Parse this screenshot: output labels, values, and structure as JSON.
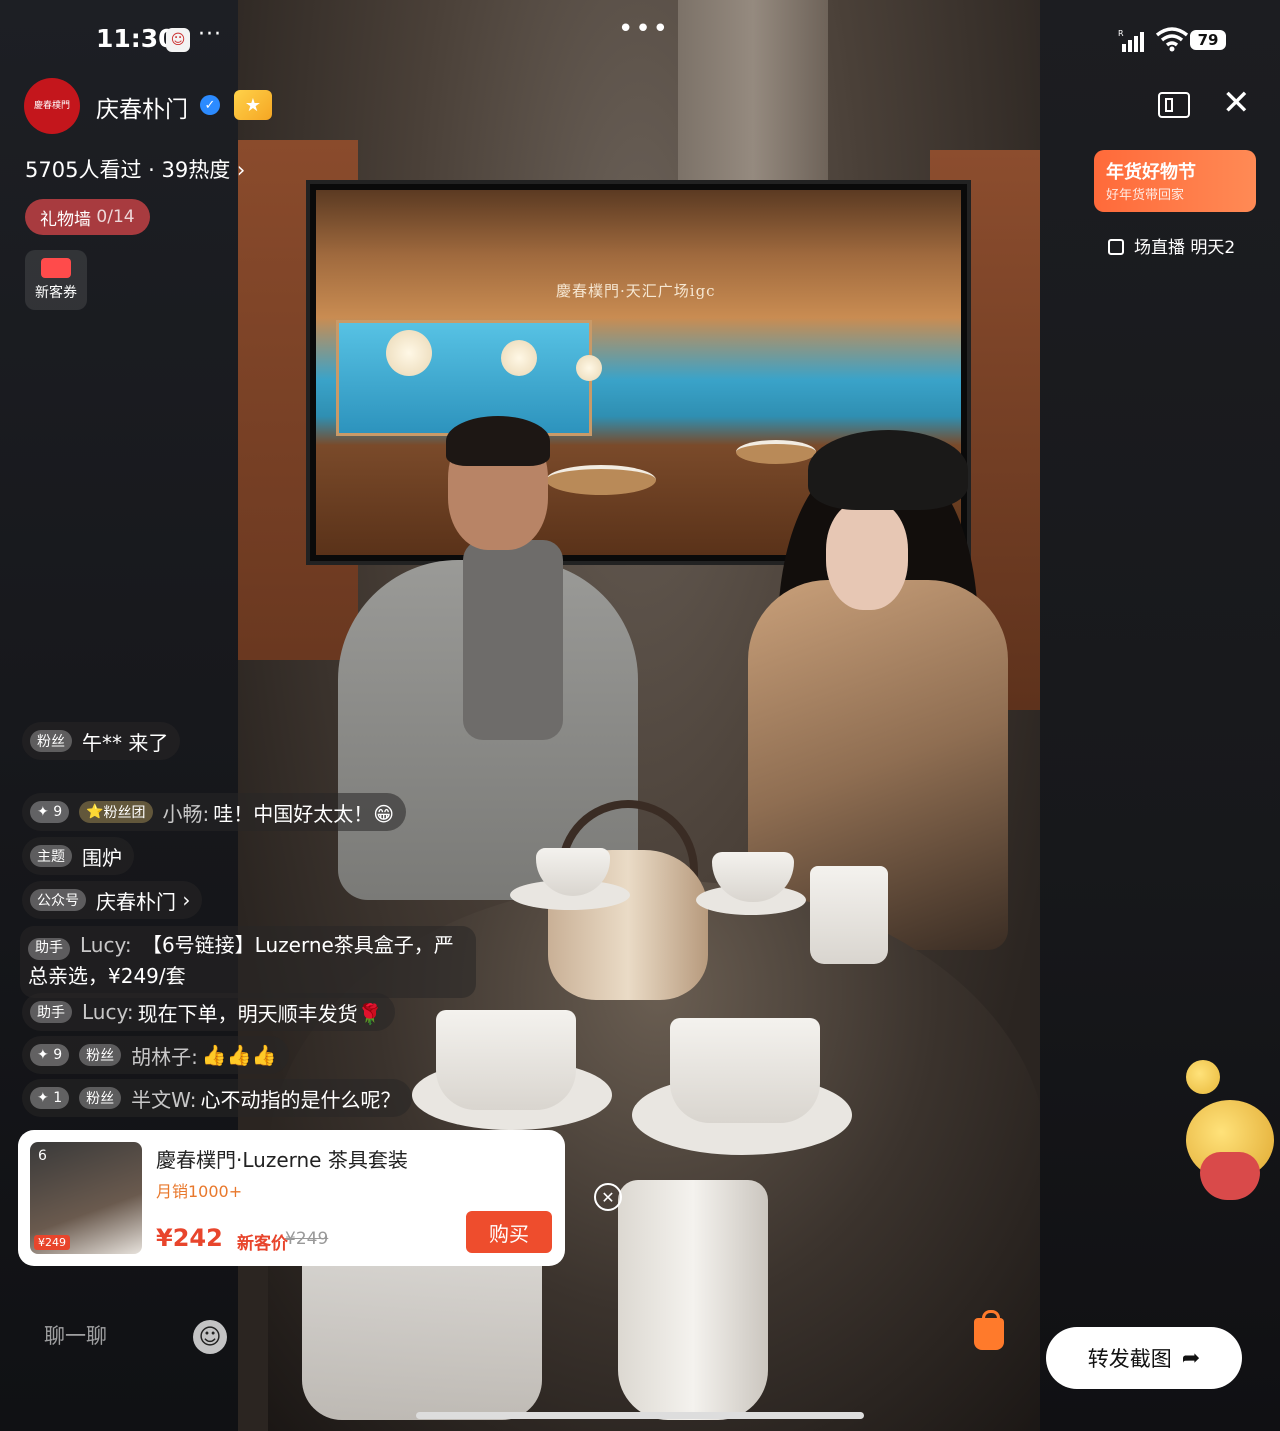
{
  "status_bar": {
    "time": "11:30",
    "dots": "···",
    "battery": "79",
    "signal_icon": "signal-r-icon",
    "wifi_icon": "wifi-icon"
  },
  "top_menu": {
    "dots": "•••"
  },
  "anchor": {
    "logo_text": "慶春樸門",
    "name": "庆春朴门",
    "viewers": "5705人看过 · 39热度",
    "viewers_arrow": "›"
  },
  "gift_wall": {
    "label": "礼物墙",
    "count": "0/14"
  },
  "coupon": {
    "label": "新客券"
  },
  "top_right": {
    "promo_title": "年货好物节",
    "promo_sub": "好年货带回家",
    "schedule": "场直播 明天2"
  },
  "video": {
    "tv_caption": "慶春樸門·天汇广场igc"
  },
  "comments": {
    "entry": {
      "tag": "粉丝",
      "text": "午** 来了"
    },
    "c1": {
      "level": "9",
      "team": "粉丝团",
      "user": "小畅:",
      "text": "哇！中国好太太！😁"
    },
    "topic": {
      "tag": "主题",
      "text": "围炉"
    },
    "account": {
      "tag": "公众号",
      "text": "庆春朴门",
      "arrow": "›"
    },
    "c2": {
      "tag": "助手",
      "user": "Lucy:",
      "text": "【6号链接】Luzerne茶具盒子，严总亲选，¥249/套"
    },
    "c3": {
      "tag": "助手",
      "user": "Lucy:",
      "text": "现在下单，明天顺丰发货🌹"
    },
    "c4": {
      "level": "9",
      "tag": "粉丝",
      "user": "胡林子:",
      "text": "👍👍👍"
    },
    "c5": {
      "level": "1",
      "tag": "粉丝",
      "user": "半文W:",
      "text": "心不动指的是什么呢？"
    }
  },
  "product": {
    "rank": "6",
    "mini_price": "¥249",
    "title": "慶春樸門·Luzerne 茶具套装",
    "sales": "月销1000+",
    "price": "¥242",
    "price_tag": "新客价",
    "old_price": "¥249",
    "buy_label": "购买"
  },
  "bottom": {
    "chat_placeholder": "聊一聊",
    "share_label": "转发截图"
  },
  "colors": {
    "accent_red": "#ee4d2d",
    "gift_wall_bg": "#a83b3f",
    "promo_orange": "#ff7a4a",
    "verified_blue": "#2c8bff"
  }
}
